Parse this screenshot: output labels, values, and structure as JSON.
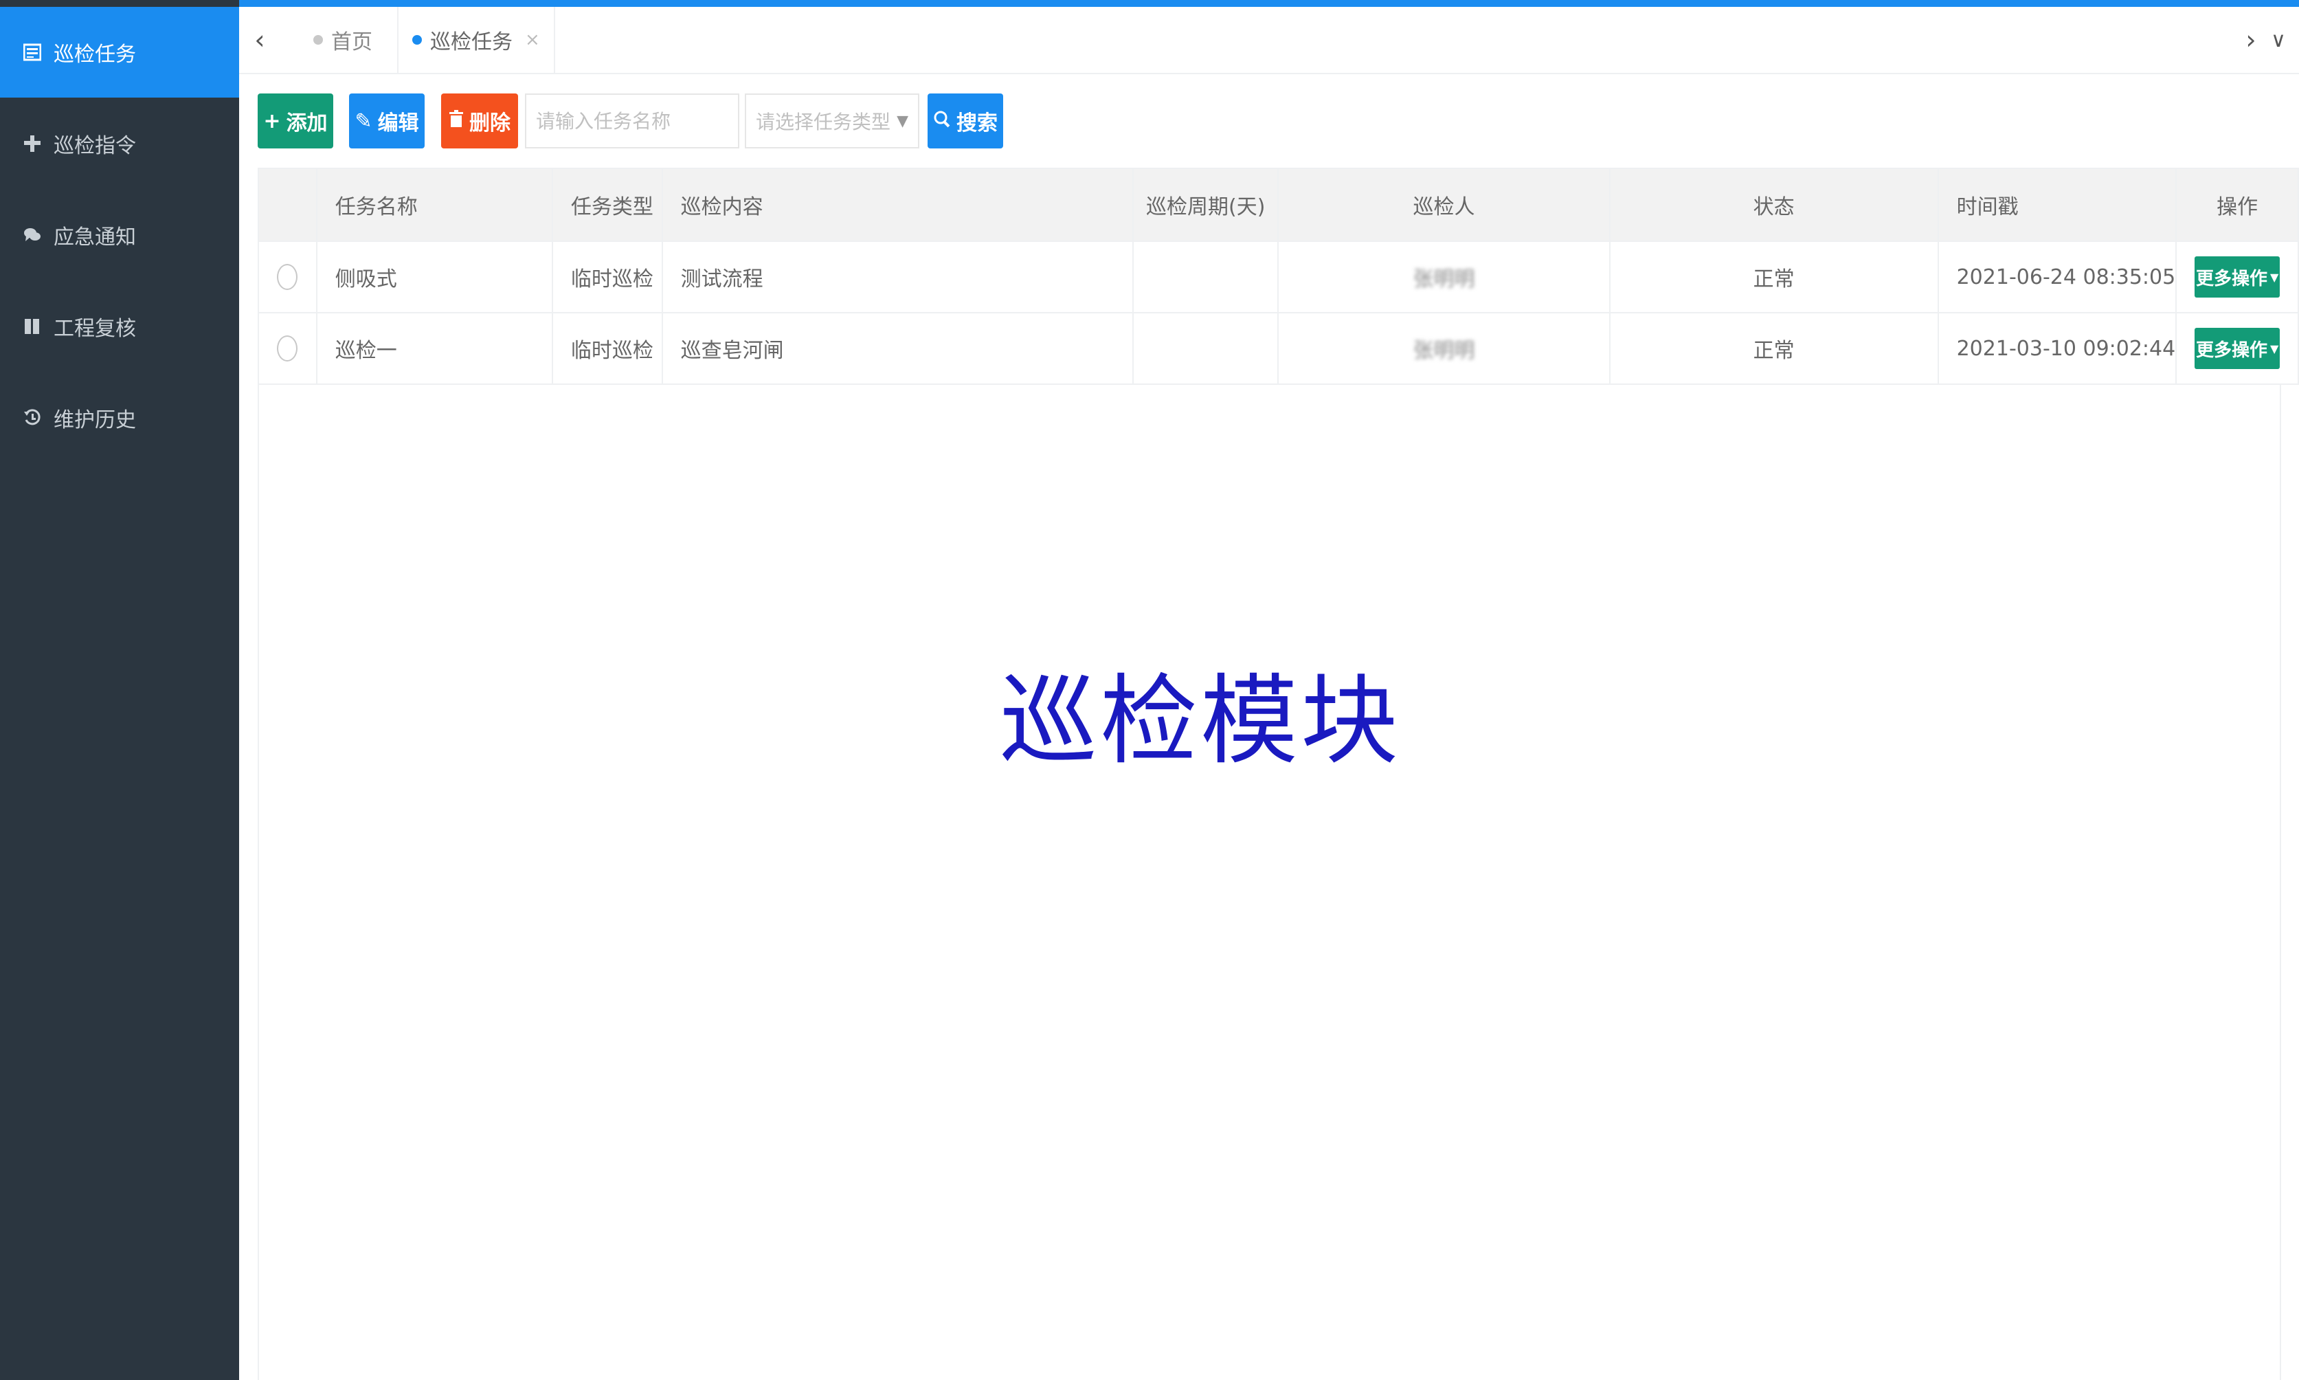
{
  "sidebar": {
    "items": [
      {
        "label": "巡检任务",
        "icon": "list-icon",
        "active": true
      },
      {
        "label": "巡检指令",
        "icon": "cross-icon",
        "active": false
      },
      {
        "label": "应急通知",
        "icon": "chat-icon",
        "active": false
      },
      {
        "label": "工程复核",
        "icon": "book-icon",
        "active": false
      },
      {
        "label": "维护历史",
        "icon": "history-icon",
        "active": false
      }
    ]
  },
  "tabs": {
    "items": [
      {
        "label": "首页",
        "active": false
      },
      {
        "label": "巡检任务",
        "active": true,
        "close": "×"
      }
    ],
    "prev_arrow": "‹",
    "next_arrow": "›",
    "menu_arrow": "∨"
  },
  "toolbar": {
    "add_label": "添加",
    "edit_label": "编辑",
    "delete_label": "删除",
    "search_placeholder": "请输入任务名称",
    "type_select_placeholder": "请选择任务类型",
    "search_label": "搜索"
  },
  "table": {
    "columns": [
      "",
      "任务名称",
      "任务类型",
      "巡检内容",
      "巡检周期(天)",
      "巡检人",
      "状态",
      "时间戳",
      "操作"
    ],
    "rows": [
      {
        "name": "侧吸式",
        "type": "临时巡检",
        "content": "测试流程",
        "cycle": "",
        "inspector": "张明明",
        "status": "正常",
        "timestamp": "2021-06-24 08:35:05",
        "action": "更多操作"
      },
      {
        "name": "巡检一",
        "type": "临时巡检",
        "content": "巡查皂河闸",
        "cycle": "",
        "inspector": "张明明",
        "status": "正常",
        "timestamp": "2021-03-10 09:02:44",
        "action": "更多操作"
      }
    ]
  },
  "overlay_caption": "巡检模块",
  "colors": {
    "sidebar_bg": "#2b3640",
    "accent": "#1a8cf0",
    "add_green": "#139b77",
    "delete_orange": "#f4511e",
    "caption_blue": "#1a1ac0"
  }
}
